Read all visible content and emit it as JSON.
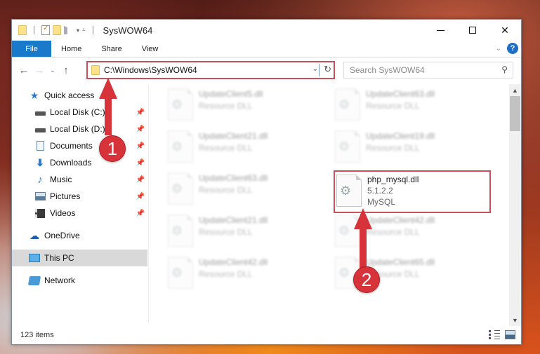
{
  "window": {
    "title": "SysWOW64",
    "controls": {
      "minimize": "Minimize",
      "maximize": "Maximize",
      "close": "✕"
    }
  },
  "ribbon": {
    "tabs": [
      {
        "label": "File",
        "active": true
      },
      {
        "label": "Home"
      },
      {
        "label": "Share"
      },
      {
        "label": "View"
      }
    ],
    "help": "?",
    "accent_color": "#1979ca"
  },
  "nav": {
    "back": "←",
    "forward": "→",
    "recent": "⌄",
    "up": "↑",
    "address": "C:\\Windows\\SysWOW64",
    "refresh": "↻",
    "search_placeholder": "Search SysWOW64"
  },
  "sidebar": {
    "items": [
      {
        "label": "Quick access",
        "icon": "star-icon"
      },
      {
        "label": "Local Disk (C:)",
        "icon": "drive-icon",
        "pinned": true
      },
      {
        "label": "Local Disk (D:)",
        "icon": "drive-icon",
        "pinned": true
      },
      {
        "label": "Documents",
        "icon": "documents-icon",
        "pinned": true
      },
      {
        "label": "Downloads",
        "icon": "downloads-icon",
        "pinned": true
      },
      {
        "label": "Music",
        "icon": "music-icon",
        "pinned": true
      },
      {
        "label": "Pictures",
        "icon": "pictures-icon",
        "pinned": true
      },
      {
        "label": "Videos",
        "icon": "videos-icon",
        "pinned": true
      },
      {
        "label": "OneDrive",
        "icon": "onedrive-icon"
      },
      {
        "label": "This PC",
        "icon": "this-pc-icon",
        "selected": true
      },
      {
        "label": "Network",
        "icon": "network-icon"
      }
    ]
  },
  "files": [
    {
      "name": "UpdateClient5.dll",
      "sub1": "Resource DLL",
      "blurred": true
    },
    {
      "name": "UpdateClient63.dll",
      "sub1": "Resource DLL",
      "blurred": true
    },
    {
      "name": "UpdateClient21.dll",
      "sub1": "Resource DLL",
      "blurred": true
    },
    {
      "name": "UpdateClient19.dll",
      "sub1": "Resource DLL",
      "blurred": true
    },
    {
      "name": "UpdateClient63.dll",
      "sub1": "Resource DLL",
      "blurred": true
    },
    {
      "name": "php_mysql.dll",
      "sub1": "5.1.2.2",
      "sub2": "MySQL",
      "blurred": false,
      "highlighted": true
    },
    {
      "name": "UpdateClient21.dll",
      "sub1": "Resource DLL",
      "blurred": true
    },
    {
      "name": "UpdateClient42.dll",
      "sub1": "Resource DLL",
      "blurred": true
    },
    {
      "name": "UpdateClient42.dll",
      "sub1": "Resource DLL",
      "blurred": true
    },
    {
      "name": "UpdateClient65.dll",
      "sub1": "Resource DLL",
      "blurred": true
    }
  ],
  "status": {
    "item_count": "123 items"
  },
  "annotations": {
    "step1": "1",
    "step2": "2",
    "color": "#d6333a"
  }
}
